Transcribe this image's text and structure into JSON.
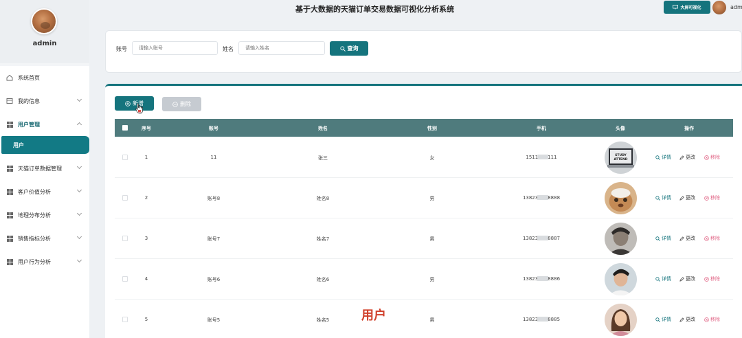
{
  "header": {
    "title": "基于大数据的天猫订单交易数据可视化分析系统",
    "big_screen_label": "大屏可视化",
    "user": "adm"
  },
  "sidebar": {
    "username": "admin",
    "items": [
      {
        "label": "系统首页",
        "icon": "home-icon",
        "chevron": false
      },
      {
        "label": "我的信息",
        "icon": "profile-icon",
        "chevron": true
      },
      {
        "label": "用户管理",
        "icon": "grid-icon",
        "chevron": true,
        "open": true
      },
      {
        "label": "天猫订单数据管理",
        "icon": "grid-icon",
        "chevron": true
      },
      {
        "label": "客户价值分析",
        "icon": "grid-icon",
        "chevron": true
      },
      {
        "label": "地理分布分析",
        "icon": "grid-icon",
        "chevron": true
      },
      {
        "label": "销售指标分析",
        "icon": "grid-icon",
        "chevron": true
      },
      {
        "label": "用户行为分析",
        "icon": "grid-icon",
        "chevron": true
      }
    ],
    "submenu_active": "用户"
  },
  "search": {
    "account_label": "账号",
    "account_placeholder": "请输入账号",
    "name_label": "姓名",
    "name_placeholder": "请输入姓名",
    "button": "查询"
  },
  "toolbar": {
    "add": "新增",
    "delete": "删除"
  },
  "table": {
    "columns": [
      "序号",
      "账号",
      "姓名",
      "性别",
      "手机",
      "头像",
      "操作"
    ],
    "actions": {
      "detail": "详情",
      "edit": "更改",
      "remove": "移除"
    },
    "rows": [
      {
        "no": "1",
        "account": "11",
        "name": "张三",
        "gender": "女",
        "phone_prefix": "1511",
        "phone_suffix": "111"
      },
      {
        "no": "2",
        "account": "账号8",
        "name": "姓名8",
        "gender": "男",
        "phone_prefix": "13823",
        "phone_suffix": "8888"
      },
      {
        "no": "3",
        "account": "账号7",
        "name": "姓名7",
        "gender": "男",
        "phone_prefix": "13823",
        "phone_suffix": "8887"
      },
      {
        "no": "4",
        "account": "账号6",
        "name": "姓名6",
        "gender": "男",
        "phone_prefix": "13823",
        "phone_suffix": "8886"
      },
      {
        "no": "5",
        "account": "账号5",
        "name": "姓名5",
        "gender": "男",
        "phone_prefix": "13823",
        "phone_suffix": "8885"
      }
    ]
  },
  "overlay_label": "用户",
  "colors": {
    "primary": "#15747d",
    "table_header": "#4f7b7d",
    "remove": "#e26a8a"
  }
}
